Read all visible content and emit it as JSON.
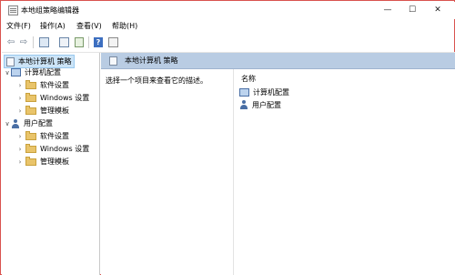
{
  "window": {
    "title": "本地组策略编辑器",
    "minimize_glyph": "—",
    "maximize_glyph": "☐",
    "close_glyph": "✕"
  },
  "menu": [
    "文件(F)",
    "操作(A)",
    "查看(V)",
    "帮助(H)"
  ],
  "toolbar": {
    "buttons": [
      {
        "name": "back-arrow-icon",
        "glyph": "⇦"
      },
      {
        "name": "forward-arrow-icon",
        "glyph": "⇨"
      },
      {
        "name": "show-tree-icon"
      },
      {
        "name": "properties-icon"
      },
      {
        "name": "export-list-icon"
      },
      {
        "name": "help-icon",
        "glyph": "?"
      },
      {
        "name": "filter-view-icon"
      }
    ]
  },
  "tree": {
    "root": "本地计算机 策略",
    "computer": {
      "label": "计算机配置",
      "children": [
        "软件设置",
        "Windows 设置",
        "管理模板"
      ]
    },
    "user": {
      "label": "用户配置",
      "children": [
        "软件设置",
        "Windows 设置",
        "管理模板"
      ]
    }
  },
  "right_pane": {
    "header": "本地计算机 策略",
    "description": "选择一个项目来查看它的描述。",
    "column_name": "名称",
    "items": [
      "计算机配置",
      "用户配置"
    ]
  }
}
